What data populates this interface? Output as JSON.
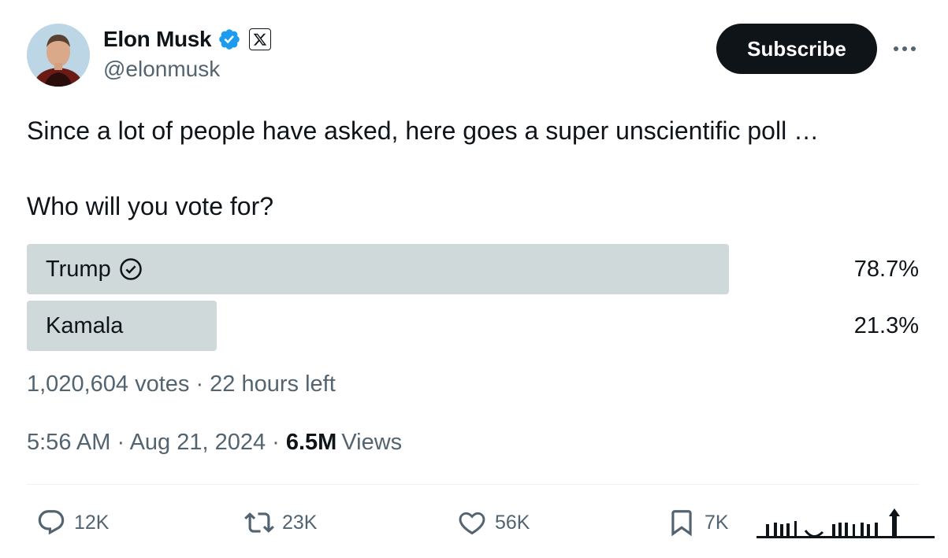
{
  "author": {
    "display_name": "Elon Musk",
    "handle": "@elonmusk",
    "verified_badge_icon": "verified-checkmark-icon",
    "affiliate_badge_icon": "x-logo-icon"
  },
  "header": {
    "subscribe_label": "Subscribe",
    "more_icon": "more-horizontal-icon"
  },
  "tweet": {
    "text": "Since a lot of people have asked, here goes a super unscientific poll …",
    "question": "Who will you vote for?"
  },
  "poll": {
    "options": [
      {
        "label": "Trump",
        "percent": "78.7%",
        "fraction": 0.787,
        "winner": true
      },
      {
        "label": "Kamala",
        "percent": "21.3%",
        "fraction": 0.213,
        "winner": false
      }
    ],
    "meta": "1,020,604 votes · 22 hours left"
  },
  "timestamp": {
    "time_date": "5:56 AM · Aug 21, 2024 ·",
    "views_count": "6.5M",
    "views_label": "Views"
  },
  "actions": {
    "replies": "12K",
    "reposts": "23K",
    "likes": "56K",
    "bookmarks": "7K"
  },
  "colors": {
    "text_primary": "#0f1419",
    "text_secondary": "#536471",
    "poll_bar": "#cfd9d9",
    "verified_blue": "#1d9bf0",
    "subscribe_bg": "#0f1419"
  }
}
